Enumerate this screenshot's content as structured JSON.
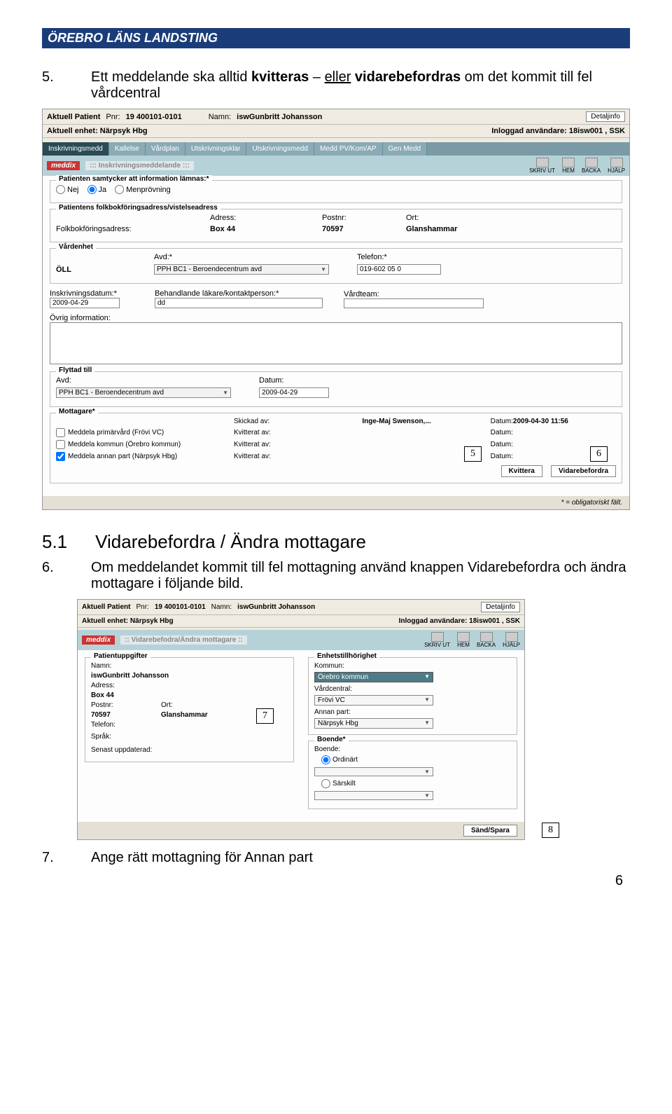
{
  "header": "ÖREBRO LÄNS LANDSTING",
  "instr5_num": "5.",
  "instr5_text_a": "Ett meddelande ska alltid ",
  "instr5_text_b": "kvitteras",
  "instr5_text_c": " – ",
  "instr5_text_d": "eller",
  "instr5_text_e": " vidarebefordras",
  "instr5_text_f": " om det kommit till fel vårdcentral",
  "ss1": {
    "info": {
      "patient_lbl": "Aktuell Patient",
      "pnr_lbl": "Pnr:",
      "pnr": "19 400101-0101",
      "namn_lbl": "Namn:",
      "namn": "iswGunbritt Johansson",
      "detalj": "Detaljinfo",
      "enhet_lbl": "Aktuell enhet:",
      "enhet": "Närpsyk Hbg",
      "user_lbl": "Inloggad användare:",
      "user": "18isw001 , SSK"
    },
    "tabs": [
      "Inskrivningsmedd",
      "Kallelse",
      "Vårdplan",
      "Utskrivningsklar",
      "Utskrivningsmedd",
      "Medd PV/Kom/AP",
      "Gen Medd"
    ],
    "panel_title": "Inskrivningsmeddelande",
    "icons": {
      "print": "SKRIV UT",
      "home": "HEM",
      "back": "BACKA",
      "help": "HJÄLP"
    },
    "samtycke": {
      "legend": "Patienten samtycker att information lämnas:*",
      "nej": "Nej",
      "ja": "Ja",
      "men": "Menprövning"
    },
    "adress": {
      "legend": "Patientens folkbokföringsadress/vistelseadress",
      "adr_lbl": "Adress:",
      "folk_lbl": "Folkbokföringsadress:",
      "box": "Box 44",
      "postnr_lbl": "Postnr:",
      "postnr": "70597",
      "ort_lbl": "Ort:",
      "ort": "Glanshammar"
    },
    "vard": {
      "legend": "Vårdenhet",
      "oll": "ÖLL",
      "avd_lbl": "Avd:*",
      "avd": "PPH BC1 - Beroendecentrum avd",
      "tel_lbl": "Telefon:*",
      "tel": "019-602 05 0"
    },
    "insk": {
      "datum_lbl": "Inskrivningsdatum:*",
      "datum": "2009-04-29",
      "lakare_lbl": "Behandlande läkare/kontaktperson:*",
      "lakare": "dd",
      "team_lbl": "Vårdteam:"
    },
    "ovrig_lbl": "Övrig information:",
    "flyttad": {
      "legend": "Flyttad till",
      "avd_lbl": "Avd:",
      "avd": "PPH BC1 - Beroendecentrum avd",
      "datum_lbl": "Datum:",
      "datum": "2009-04-29"
    },
    "mott": {
      "legend": "Mottagare*",
      "skickad_lbl": "Skickad av:",
      "skickad_val": "Inge-Maj Swenson,...",
      "skickad_dat_lbl": "Datum:",
      "skickad_dat": "2009-04-30 11:56",
      "kvitt_lbl": "Kvitterat av:",
      "dat_lbl": "Datum:",
      "r1": "Meddela primärvård  (Frövi VC)",
      "r2": "Meddela kommun  (Örebro kommun)",
      "r3": "Meddela annan part (Närpsyk Hbg)",
      "btn_kvittera": "Kvittera",
      "btn_vidare": "Vidarebefordra"
    },
    "oblig": "* = obligatoriskt fält.",
    "annot5": "5",
    "annot6": "6"
  },
  "sec51_num": "5.1",
  "sec51_title": "Vidarebefordra / Ändra mottagare",
  "instr6_num": "6.",
  "instr6_text": "Om meddelandet kommit till fel mottagning använd knappen Vidarebefordra och ändra mottagare i följande bild.",
  "ss2": {
    "info": {
      "patient_lbl": "Aktuell Patient",
      "pnr_lbl": "Pnr:",
      "pnr": "19 400101-0101",
      "namn_lbl": "Namn:",
      "namn": "iswGunbritt Johansson",
      "detalj": "Detaljinfo",
      "enhet_lbl": "Aktuell enhet:",
      "enhet": "Närpsyk Hbg",
      "user_lbl": "Inloggad användare:",
      "user": "18isw001 , SSK"
    },
    "panel_title": "Vidarebefodra/Ändra mottagare",
    "icons": {
      "print": "SKRIV UT",
      "home": "HEM",
      "back": "BACKA",
      "help": "HJÄLP"
    },
    "pat": {
      "legend": "Patientuppgifter",
      "namn_lbl": "Namn:",
      "namn": "iswGunbritt Johansson",
      "adr_lbl": "Adress:",
      "adr": "Box 44",
      "postnr_lbl": "Postnr:",
      "postnr": "70597",
      "ort_lbl": "Ort:",
      "ort": "Glanshammar",
      "tel_lbl": "Telefon:",
      "sprak_lbl": "Språk:",
      "senast_lbl": "Senast uppdaterad:"
    },
    "enh": {
      "legend": "Enhetstillhörighet",
      "kommun_lbl": "Kommun:",
      "kommun": "Örebro kommun",
      "vc_lbl": "Vårdcentral:",
      "vc": "Frövi VC",
      "ap_lbl": "Annan part:",
      "ap": "Närpsyk Hbg"
    },
    "bo": {
      "legend": "Boende*",
      "bo_lbl": "Boende:",
      "ord": "Ordinärt",
      "sar": "Särskilt"
    },
    "send": "Sänd/Spara",
    "annot7": "7",
    "annot8": "8"
  },
  "instr7_num": "7.",
  "instr7_text": "Ange rätt mottagning för Annan part",
  "page_num": "6"
}
